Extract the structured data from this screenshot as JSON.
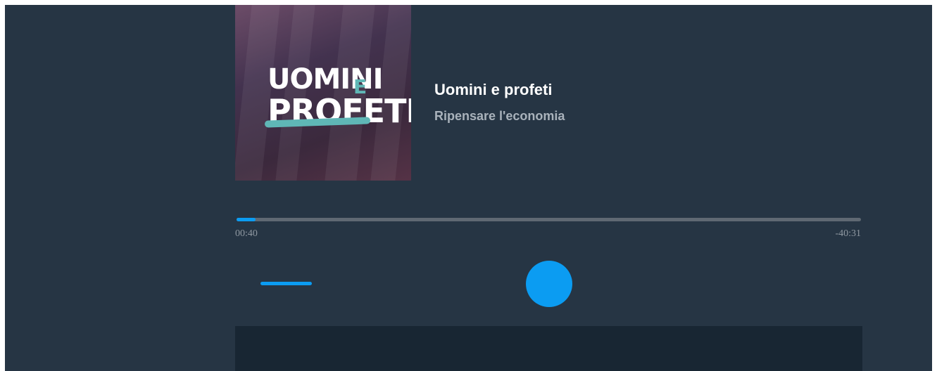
{
  "cover": {
    "word1": "UOMINI",
    "word2": "PROFETI",
    "letter_e": "E"
  },
  "episode": {
    "title": "Uomini e profeti",
    "subtitle": "Ripensare l'economia"
  },
  "player": {
    "elapsed": "00:40",
    "remaining": "-40:31",
    "progress_fraction": 0.016
  },
  "colors": {
    "background": "#263544",
    "accent": "#0b9cf2",
    "track": "#5f6973",
    "panel": "#182633"
  }
}
